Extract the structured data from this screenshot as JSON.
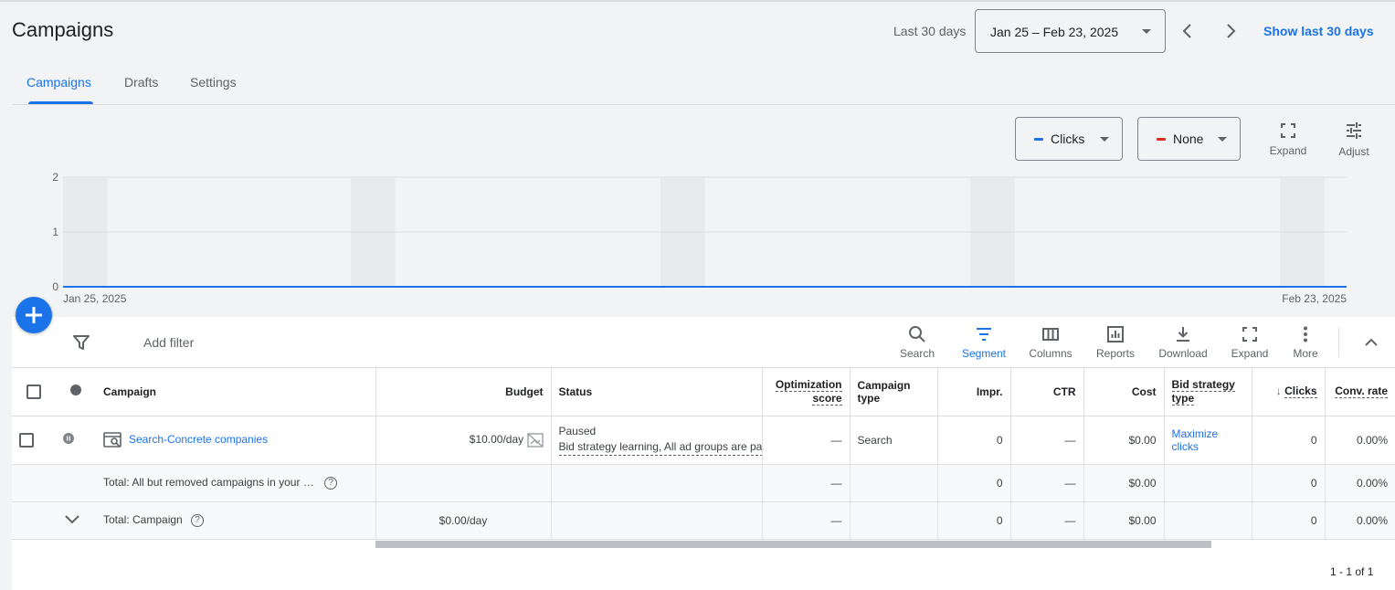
{
  "header": {
    "title": "Campaigns",
    "range_label": "Last 30 days",
    "date_range": "Jan 25 – Feb 23, 2025",
    "show_last_30": "Show last 30 days"
  },
  "tabs": [
    {
      "label": "Campaigns",
      "active": true
    },
    {
      "label": "Drafts",
      "active": false
    },
    {
      "label": "Settings",
      "active": false
    }
  ],
  "chart_controls": {
    "metric1": {
      "label": "Clicks",
      "color": "#1a73e8"
    },
    "metric2": {
      "label": "None",
      "color": "#d93025"
    },
    "expand_label": "Expand",
    "adjust_label": "Adjust"
  },
  "chart_data": {
    "type": "line",
    "x_start": "Jan 25, 2025",
    "x_end": "Feb 23, 2025",
    "yticks": [
      "0",
      "1",
      "2"
    ],
    "ylim": [
      0,
      2
    ],
    "series": [
      {
        "name": "Clicks",
        "color": "#1a73e8",
        "values": [
          0,
          0,
          0,
          0,
          0,
          0,
          0,
          0,
          0,
          0,
          0,
          0,
          0,
          0,
          0,
          0,
          0,
          0,
          0,
          0,
          0,
          0,
          0,
          0,
          0,
          0,
          0,
          0,
          0,
          0
        ]
      }
    ]
  },
  "toolbar": {
    "add_filter": "Add filter",
    "search": "Search",
    "segment": "Segment",
    "columns": "Columns",
    "reports": "Reports",
    "download": "Download",
    "expand": "Expand",
    "more": "More"
  },
  "table": {
    "headers": {
      "campaign": "Campaign",
      "budget": "Budget",
      "status": "Status",
      "opt_score_1": "Optimization",
      "opt_score_2": "score",
      "campaign_type_1": "Campaign",
      "campaign_type_2": "type",
      "impr": "Impr.",
      "ctr": "CTR",
      "cost": "Cost",
      "bid_strategy_1": "Bid strategy",
      "bid_strategy_2": "type",
      "clicks": "Clicks",
      "conv_rate": "Conv. rate"
    },
    "row": {
      "campaign": "Search-Concrete companies",
      "budget": "$10.00/day",
      "status": "Paused",
      "status_detail": "Bid strategy learning, All ad groups are paused",
      "opt_score": "—",
      "campaign_type": "Search",
      "impr": "0",
      "ctr": "—",
      "cost": "$0.00",
      "bid_strategy_1": "Maximize",
      "bid_strategy_2": "clicks",
      "clicks": "0",
      "conv_rate": "0.00%"
    },
    "total1": {
      "label": "Total: All but removed campaigns in your …",
      "opt_score": "—",
      "impr": "0",
      "ctr": "—",
      "cost": "$0.00",
      "clicks": "0",
      "conv_rate": "0.00%"
    },
    "total2": {
      "label": "Total: Campaign",
      "budget": "$0.00/day",
      "opt_score": "—",
      "impr": "0",
      "ctr": "—",
      "cost": "$0.00",
      "clicks": "0",
      "conv_rate": "0.00%"
    }
  },
  "pagination": "1 - 1 of 1"
}
